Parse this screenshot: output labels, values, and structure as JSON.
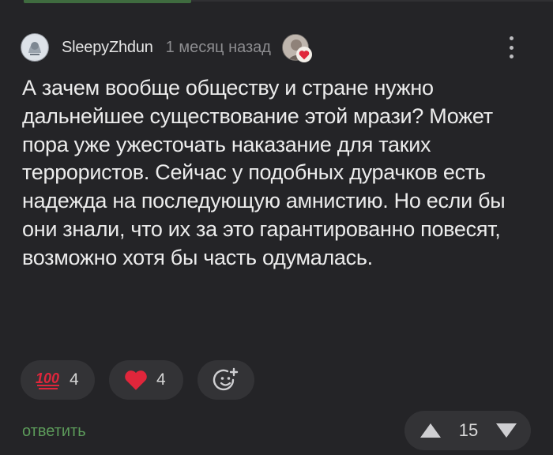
{
  "comment": {
    "author": "SleepyZhdun",
    "time": "1 месяц назад",
    "text": "А зачем вообще обществу и стране нужно дальнейшее существование этой мрази? Может пора уже ужесточать наказание для таких террористов. Сейчас у подобных дурачков есть надежда на последующую амнистию. Но если бы они знали, что их за это гарантированно повесят, возможно хотя бы часть одумалась."
  },
  "reactions": [
    {
      "icon": "hundred-points-icon",
      "count": "4"
    },
    {
      "icon": "heart-icon",
      "count": "4"
    },
    {
      "icon": "add-reaction-icon"
    }
  ],
  "actions": {
    "reply_label": "ответить"
  },
  "vote": {
    "score": "15"
  },
  "colors": {
    "background": "#242427",
    "chip": "#333336",
    "accent_green": "#5c9a5a",
    "heart_red": "#e0263b"
  }
}
